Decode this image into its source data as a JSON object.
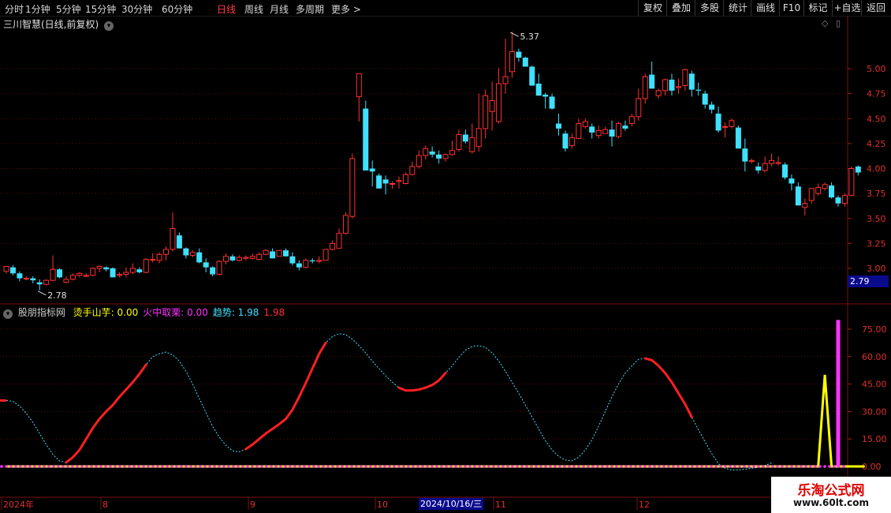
{
  "toolbar": {
    "periods": [
      "分时",
      "1分钟",
      "5分钟",
      "15分钟",
      "30分钟",
      "60分钟",
      "日线",
      "周线",
      "月线",
      "多周期",
      "更多 >"
    ],
    "active_period": "日线",
    "right_buttons": [
      "复权",
      "叠加",
      "多股",
      "统计",
      "画线",
      "F10",
      "标记",
      "+自选",
      "返回"
    ]
  },
  "main_chart": {
    "title": "三川智慧(日线,前复权)",
    "current_price_tag": "2.79",
    "high_label": "5.37",
    "low_label": "2.78"
  },
  "indicator": {
    "title": "股朋指标网",
    "items": [
      {
        "label": "烫手山芋: 0.00",
        "color": "#ffff00"
      },
      {
        "label": "火中取栗: 0.00",
        "color": "#ff33ff"
      },
      {
        "label": "趋势: 1.98",
        "color": "#40e0ff"
      },
      {
        "label": "1.98",
        "color": "#ff3030"
      }
    ]
  },
  "x_axis": {
    "labels": [
      "2024年",
      "8",
      "9",
      "10",
      "11",
      "12"
    ],
    "cursor_date": "2024/10/16/三"
  },
  "watermark": {
    "title": "乐淘公式网",
    "url": "www.60lt.com"
  },
  "chart_data": [
    {
      "type": "candlestick",
      "title": "三川智慧(日线,前复权)",
      "y_ticks": [
        "5.00",
        "4.75",
        "4.50",
        "4.25",
        "4.00",
        "3.75",
        "3.50",
        "3.25",
        "3.00"
      ],
      "ylim": [
        2.7,
        5.45
      ],
      "grid": true,
      "candles": [
        [
          2.97,
          3.02,
          2.95,
          3.02
        ],
        [
          3.01,
          3.03,
          2.93,
          2.95
        ],
        [
          2.95,
          2.97,
          2.87,
          2.9
        ],
        [
          2.9,
          2.92,
          2.88,
          2.9
        ],
        [
          2.9,
          2.92,
          2.85,
          2.88
        ],
        [
          2.86,
          2.89,
          2.78,
          2.84
        ],
        [
          2.84,
          2.89,
          2.83,
          2.88
        ],
        [
          2.88,
          3.13,
          2.87,
          2.99
        ],
        [
          2.99,
          3.0,
          2.9,
          2.91
        ],
        [
          2.86,
          2.92,
          2.85,
          2.89
        ],
        [
          2.89,
          2.95,
          2.88,
          2.93
        ],
        [
          2.93,
          2.96,
          2.91,
          2.95
        ],
        [
          2.92,
          2.95,
          2.91,
          2.93
        ],
        [
          2.93,
          3.01,
          2.92,
          3.0
        ],
        [
          3.0,
          3.03,
          2.96,
          3.02
        ],
        [
          3.01,
          3.02,
          2.97,
          2.99
        ],
        [
          3.0,
          3.01,
          2.91,
          2.91
        ],
        [
          2.93,
          2.96,
          2.91,
          2.94
        ],
        [
          2.94,
          3.01,
          2.91,
          2.96
        ],
        [
          2.96,
          3.05,
          2.94,
          3.0
        ],
        [
          2.99,
          3.01,
          2.95,
          2.96
        ],
        [
          2.96,
          3.1,
          2.95,
          3.09
        ],
        [
          3.09,
          3.15,
          3.06,
          3.09
        ],
        [
          3.08,
          3.16,
          3.05,
          3.14
        ],
        [
          3.14,
          3.22,
          3.08,
          3.19
        ],
        [
          3.19,
          3.56,
          3.17,
          3.4
        ],
        [
          3.33,
          3.36,
          3.2,
          3.2
        ],
        [
          3.2,
          3.21,
          3.1,
          3.13
        ],
        [
          3.13,
          3.18,
          3.11,
          3.16
        ],
        [
          3.16,
          3.2,
          3.05,
          3.06
        ],
        [
          3.06,
          3.1,
          2.96,
          3.01
        ],
        [
          3.01,
          3.02,
          2.92,
          2.94
        ],
        [
          2.94,
          3.08,
          2.93,
          3.07
        ],
        [
          3.07,
          3.15,
          3.04,
          3.12
        ],
        [
          3.12,
          3.14,
          3.07,
          3.08
        ],
        [
          3.08,
          3.13,
          3.07,
          3.11
        ],
        [
          3.1,
          3.13,
          3.08,
          3.11
        ],
        [
          3.1,
          3.15,
          3.09,
          3.12
        ],
        [
          3.09,
          3.16,
          3.08,
          3.14
        ],
        [
          3.14,
          3.19,
          3.13,
          3.18
        ],
        [
          3.17,
          3.2,
          3.1,
          3.1
        ],
        [
          3.12,
          3.18,
          3.12,
          3.18
        ],
        [
          3.18,
          3.2,
          3.12,
          3.12
        ],
        [
          3.12,
          3.16,
          3.03,
          3.05
        ],
        [
          3.05,
          3.08,
          2.98,
          3.01
        ],
        [
          3.01,
          3.1,
          3.0,
          3.08
        ],
        [
          3.08,
          3.1,
          3.05,
          3.07
        ],
        [
          3.07,
          3.12,
          3.05,
          3.08
        ],
        [
          3.08,
          3.19,
          3.08,
          3.19
        ],
        [
          3.19,
          3.28,
          3.18,
          3.25
        ],
        [
          3.2,
          3.4,
          3.2,
          3.35
        ],
        [
          3.35,
          3.56,
          3.34,
          3.53
        ],
        [
          3.52,
          4.15,
          3.5,
          4.1
        ],
        [
          4.72,
          4.95,
          4.47,
          4.95
        ],
        [
          4.6,
          4.68,
          3.98,
          3.98
        ],
        [
          4.0,
          4.08,
          3.82,
          3.97
        ],
        [
          3.93,
          3.95,
          3.8,
          3.8
        ],
        [
          3.89,
          3.93,
          3.74,
          3.85
        ],
        [
          3.85,
          3.87,
          3.8,
          3.85
        ],
        [
          3.87,
          3.92,
          3.8,
          3.88
        ],
        [
          3.85,
          3.96,
          3.84,
          3.94
        ],
        [
          3.94,
          4.07,
          3.93,
          4.02
        ],
        [
          4.02,
          4.18,
          4.0,
          4.13
        ],
        [
          4.13,
          4.23,
          4.09,
          4.2
        ],
        [
          4.17,
          4.22,
          4.11,
          4.14
        ],
        [
          4.14,
          4.18,
          4.05,
          4.1
        ],
        [
          4.1,
          4.15,
          4.07,
          4.14
        ],
        [
          4.14,
          4.28,
          4.13,
          4.18
        ],
        [
          4.19,
          4.39,
          4.17,
          4.34
        ],
        [
          4.34,
          4.39,
          4.25,
          4.27
        ],
        [
          4.17,
          4.45,
          4.15,
          4.31
        ],
        [
          4.22,
          4.75,
          4.17,
          4.4
        ],
        [
          4.4,
          4.79,
          4.3,
          4.73
        ],
        [
          4.57,
          4.87,
          4.38,
          4.68
        ],
        [
          4.47,
          5.01,
          4.45,
          4.85
        ],
        [
          4.85,
          5.3,
          4.75,
          4.92
        ],
        [
          4.97,
          5.37,
          4.91,
          5.17
        ],
        [
          5.17,
          5.2,
          5.07,
          5.11
        ],
        [
          5.11,
          5.12,
          5.02,
          5.02
        ],
        [
          5.02,
          5.03,
          4.83,
          4.83
        ],
        [
          4.85,
          4.95,
          4.73,
          4.73
        ],
        [
          4.74,
          4.76,
          4.6,
          4.72
        ],
        [
          4.72,
          4.75,
          4.59,
          4.6
        ],
        [
          4.45,
          4.55,
          4.33,
          4.4
        ],
        [
          4.35,
          4.38,
          4.17,
          4.2
        ],
        [
          4.23,
          4.35,
          4.2,
          4.31
        ],
        [
          4.3,
          4.5,
          4.3,
          4.45
        ],
        [
          4.42,
          4.5,
          4.4,
          4.47
        ],
        [
          4.42,
          4.45,
          4.3,
          4.36
        ],
        [
          4.33,
          4.43,
          4.3,
          4.38
        ],
        [
          4.35,
          4.42,
          4.35,
          4.39
        ],
        [
          4.39,
          4.48,
          4.22,
          4.32
        ],
        [
          4.32,
          4.47,
          4.3,
          4.45
        ],
        [
          4.43,
          4.48,
          4.38,
          4.4
        ],
        [
          4.45,
          4.55,
          4.42,
          4.52
        ],
        [
          4.52,
          4.8,
          4.48,
          4.7
        ],
        [
          4.7,
          4.95,
          4.65,
          4.92
        ],
        [
          4.94,
          5.07,
          4.88,
          4.8
        ],
        [
          4.73,
          4.8,
          4.7,
          4.78
        ],
        [
          4.78,
          4.9,
          4.73,
          4.89
        ],
        [
          4.89,
          4.95,
          4.73,
          4.78
        ],
        [
          4.81,
          4.9,
          4.75,
          4.82
        ],
        [
          4.83,
          5.0,
          4.78,
          4.99
        ],
        [
          4.95,
          4.98,
          4.72,
          4.79
        ],
        [
          4.79,
          4.86,
          4.73,
          4.78
        ],
        [
          4.75,
          4.78,
          4.6,
          4.64
        ],
        [
          4.64,
          4.67,
          4.55,
          4.59
        ],
        [
          4.55,
          4.62,
          4.36,
          4.38
        ],
        [
          4.42,
          4.46,
          4.31,
          4.42
        ],
        [
          4.42,
          4.5,
          4.4,
          4.48
        ],
        [
          4.41,
          4.43,
          4.2,
          4.2
        ],
        [
          4.2,
          4.3,
          3.97,
          4.07
        ],
        [
          4.07,
          4.1,
          4.05,
          4.08
        ],
        [
          4.02,
          4.06,
          3.95,
          3.98
        ],
        [
          3.98,
          4.12,
          3.96,
          4.05
        ],
        [
          4.05,
          4.15,
          4.02,
          4.08
        ],
        [
          4.05,
          4.12,
          4.03,
          4.06
        ],
        [
          4.04,
          4.06,
          3.89,
          3.91
        ],
        [
          3.9,
          3.94,
          3.78,
          3.85
        ],
        [
          3.82,
          3.86,
          3.63,
          3.63
        ],
        [
          3.61,
          3.7,
          3.53,
          3.65
        ],
        [
          3.68,
          3.8,
          3.65,
          3.8
        ],
        [
          3.75,
          3.85,
          3.73,
          3.81
        ],
        [
          3.8,
          3.86,
          3.78,
          3.84
        ],
        [
          3.83,
          3.86,
          3.7,
          3.71
        ],
        [
          3.71,
          3.73,
          3.62,
          3.65
        ],
        [
          3.65,
          3.75,
          3.62,
          3.73
        ],
        [
          3.73,
          4.02,
          3.72,
          4.0
        ],
        [
          4.02,
          4.03,
          3.93,
          3.96
        ]
      ]
    },
    {
      "type": "line",
      "title": "股朋指标网",
      "y_ticks": [
        "75.00",
        "60.00",
        "45.00",
        "30.00",
        "15.00",
        "0.00"
      ],
      "ylim": [
        -4,
        85
      ],
      "trend_up_ranges": [
        [
          9,
          21
        ],
        [
          36,
          48
        ],
        [
          59,
          66
        ],
        [
          96,
          103
        ],
        [
          127,
          129
        ]
      ],
      "series": [
        {
          "name": "趋势",
          "color": "#40e0ff",
          "values": [
            36,
            35.5,
            33,
            29,
            24,
            18,
            12,
            6.5,
            3,
            2.2,
            5,
            9,
            15,
            21,
            26,
            30,
            33.5,
            38,
            42,
            46,
            50.5,
            55.5,
            60,
            61.5,
            62.5,
            61,
            57.5,
            52,
            45,
            37,
            29.5,
            22,
            16,
            11.5,
            8.5,
            8,
            9.5,
            12,
            15,
            18,
            20.5,
            23,
            26,
            31,
            38,
            45.5,
            53.5,
            61.5,
            67.5,
            71,
            72.5,
            72,
            69.5,
            66,
            62,
            57.5,
            53.5,
            49.5,
            46,
            43,
            41.5,
            41.5,
            42,
            43,
            44.5,
            47,
            51,
            55,
            59.5,
            63.5,
            65.5,
            66,
            65,
            62,
            57.5,
            52,
            46,
            40,
            33.5,
            27,
            20.5,
            14,
            9,
            5.5,
            3.5,
            3,
            5,
            9,
            14.5,
            22,
            30,
            38,
            45,
            51,
            55,
            58.5,
            59,
            58,
            55,
            51,
            46,
            40,
            34,
            27,
            20,
            13.5,
            7,
            1.5,
            -1,
            -2,
            -1.8,
            -1.5,
            -1,
            -0.5,
            0.5,
            1.98
          ]
        },
        {
          "name": "烫手山芋",
          "color": "#ffff00",
          "values": [
            0,
            0,
            0,
            0,
            0,
            0,
            0,
            0,
            0,
            0,
            0,
            0,
            0,
            0,
            0,
            0,
            0,
            0,
            0,
            0,
            0,
            0,
            0,
            0,
            0,
            0,
            0,
            0,
            0,
            0,
            0,
            0,
            0,
            0,
            0,
            0,
            0,
            0,
            0,
            0,
            0,
            0,
            0,
            0,
            0,
            0,
            0,
            0,
            0,
            0,
            0,
            0,
            0,
            0,
            0,
            0,
            0,
            0,
            0,
            0,
            0,
            0,
            0,
            0,
            0,
            0,
            0,
            0,
            0,
            0,
            0,
            0,
            0,
            0,
            0,
            0,
            0,
            0,
            0,
            0,
            0,
            0,
            0,
            0,
            0,
            0,
            0,
            0,
            0,
            0,
            0,
            0,
            0,
            0,
            0,
            0,
            0,
            0,
            0,
            0,
            0,
            0,
            0,
            0,
            0,
            0,
            0,
            0,
            0,
            0,
            0,
            0,
            0,
            0,
            0,
            0,
            0,
            0,
            0,
            0,
            0,
            0,
            0,
            50,
            0,
            0,
            0,
            0,
            0,
            0
          ]
        },
        {
          "name": "火中取栗",
          "color": "#ff33ff",
          "values": [
            0,
            0,
            0,
            0,
            0,
            0,
            0,
            0,
            0,
            0,
            0,
            0,
            0,
            0,
            0,
            0,
            0,
            0,
            0,
            0,
            0,
            0,
            0,
            0,
            0,
            0,
            0,
            0,
            0,
            0,
            0,
            0,
            0,
            0,
            0,
            0,
            0,
            0,
            0,
            0,
            0,
            0,
            0,
            0,
            0,
            0,
            0,
            0,
            0,
            0,
            0,
            0,
            0,
            0,
            0,
            0,
            0,
            0,
            0,
            0,
            0,
            0,
            0,
            0,
            0,
            0,
            0,
            0,
            0,
            0,
            0,
            0,
            0,
            0,
            0,
            0,
            0,
            0,
            0,
            0,
            0,
            0,
            0,
            0,
            0,
            0,
            0,
            0,
            0,
            0,
            0,
            0,
            0,
            0,
            0,
            0,
            0,
            0,
            0,
            0,
            0,
            0,
            0,
            0,
            0,
            0,
            0,
            0,
            0,
            0,
            0,
            0,
            0,
            0,
            0,
            0,
            0,
            0,
            0,
            0,
            0,
            0,
            0,
            0,
            0,
            80,
            0,
            0,
            0,
            0
          ]
        }
      ]
    }
  ]
}
